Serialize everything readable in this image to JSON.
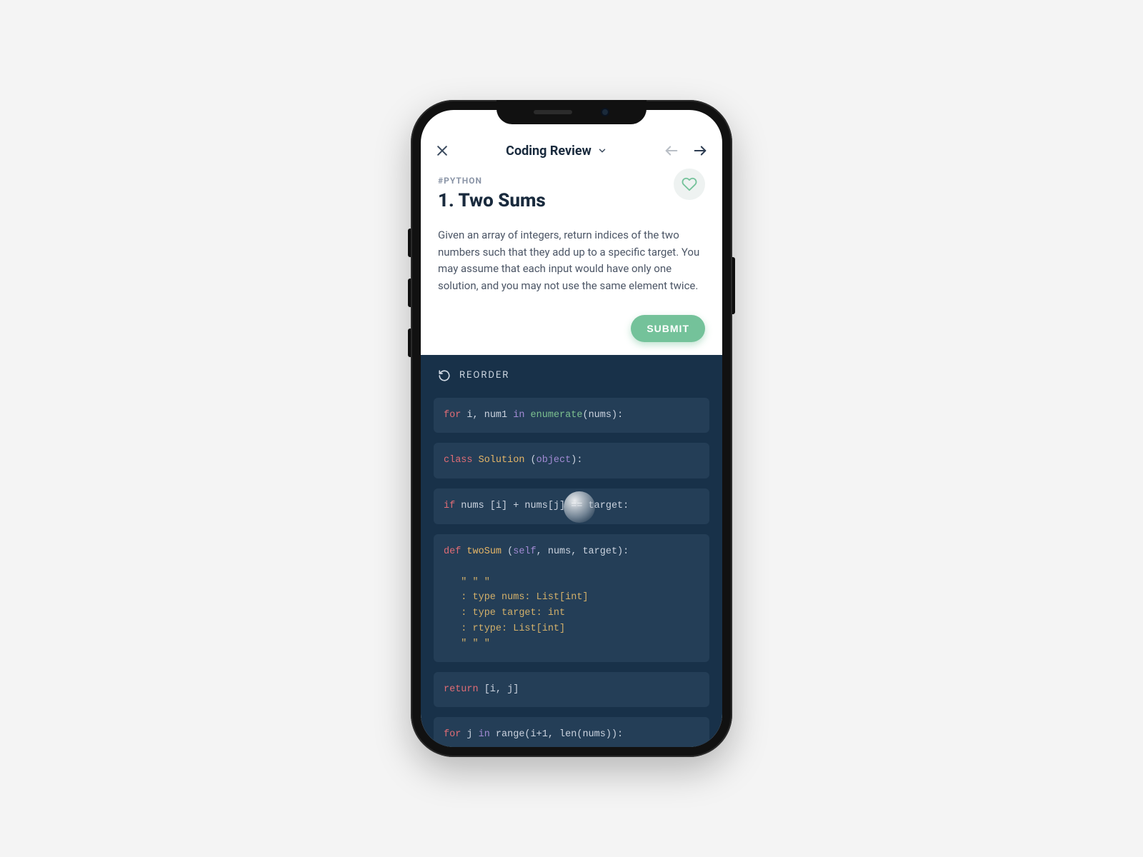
{
  "header": {
    "title": "Coding Review"
  },
  "question": {
    "tag": "#PYTHON",
    "title": "1. Two Sums",
    "description": "Given an array of integers, return indices of the two numbers such that they add up to a specific target. You may assume that each input would have only one solution, and you may not use the same element twice."
  },
  "actions": {
    "submit_label": "SUBMIT",
    "reorder_label": "REORDER"
  },
  "code_blocks": [
    {
      "id": "blk-for-enum",
      "tokens": [
        {
          "t": "for",
          "c": "kw-red"
        },
        {
          "t": " i, num1 ",
          "c": "plain"
        },
        {
          "t": "in",
          "c": "kw-purple"
        },
        {
          "t": " ",
          "c": "plain"
        },
        {
          "t": "enumerate",
          "c": "fn-green"
        },
        {
          "t": "(nums):",
          "c": "plain"
        }
      ]
    },
    {
      "id": "blk-class",
      "tokens": [
        {
          "t": "class ",
          "c": "kw-red"
        },
        {
          "t": "Solution",
          "c": "name-or"
        },
        {
          "t": " (",
          "c": "plain"
        },
        {
          "t": "object",
          "c": "kw-purple"
        },
        {
          "t": "):",
          "c": "plain"
        }
      ]
    },
    {
      "id": "blk-if",
      "tokens": [
        {
          "t": "if",
          "c": "kw-red"
        },
        {
          "t": " nums [i] + nums[j] == target:",
          "c": "plain"
        }
      ]
    },
    {
      "id": "blk-def",
      "tokens": [
        {
          "t": "def",
          "c": "kw-red"
        },
        {
          "t": " ",
          "c": "plain"
        },
        {
          "t": "twoSum",
          "c": "name-or"
        },
        {
          "t": " (",
          "c": "plain"
        },
        {
          "t": "self",
          "c": "kw-purple"
        },
        {
          "t": ", nums, target):",
          "c": "plain"
        },
        {
          "t": "\n\n   \" \" \"\n   : type nums: List[int]\n   : type target: int\n   : rtype: List[int]\n   \" \" \"",
          "c": "doc-gold"
        }
      ]
    },
    {
      "id": "blk-return",
      "tokens": [
        {
          "t": "return",
          "c": "kw-red"
        },
        {
          "t": " [i, j]",
          "c": "plain"
        }
      ]
    },
    {
      "id": "blk-for-range",
      "tokens": [
        {
          "t": "for",
          "c": "kw-red"
        },
        {
          "t": " j ",
          "c": "plain"
        },
        {
          "t": "in",
          "c": "kw-purple"
        },
        {
          "t": " range(i+1, len(nums)):",
          "c": "plain"
        }
      ]
    }
  ]
}
